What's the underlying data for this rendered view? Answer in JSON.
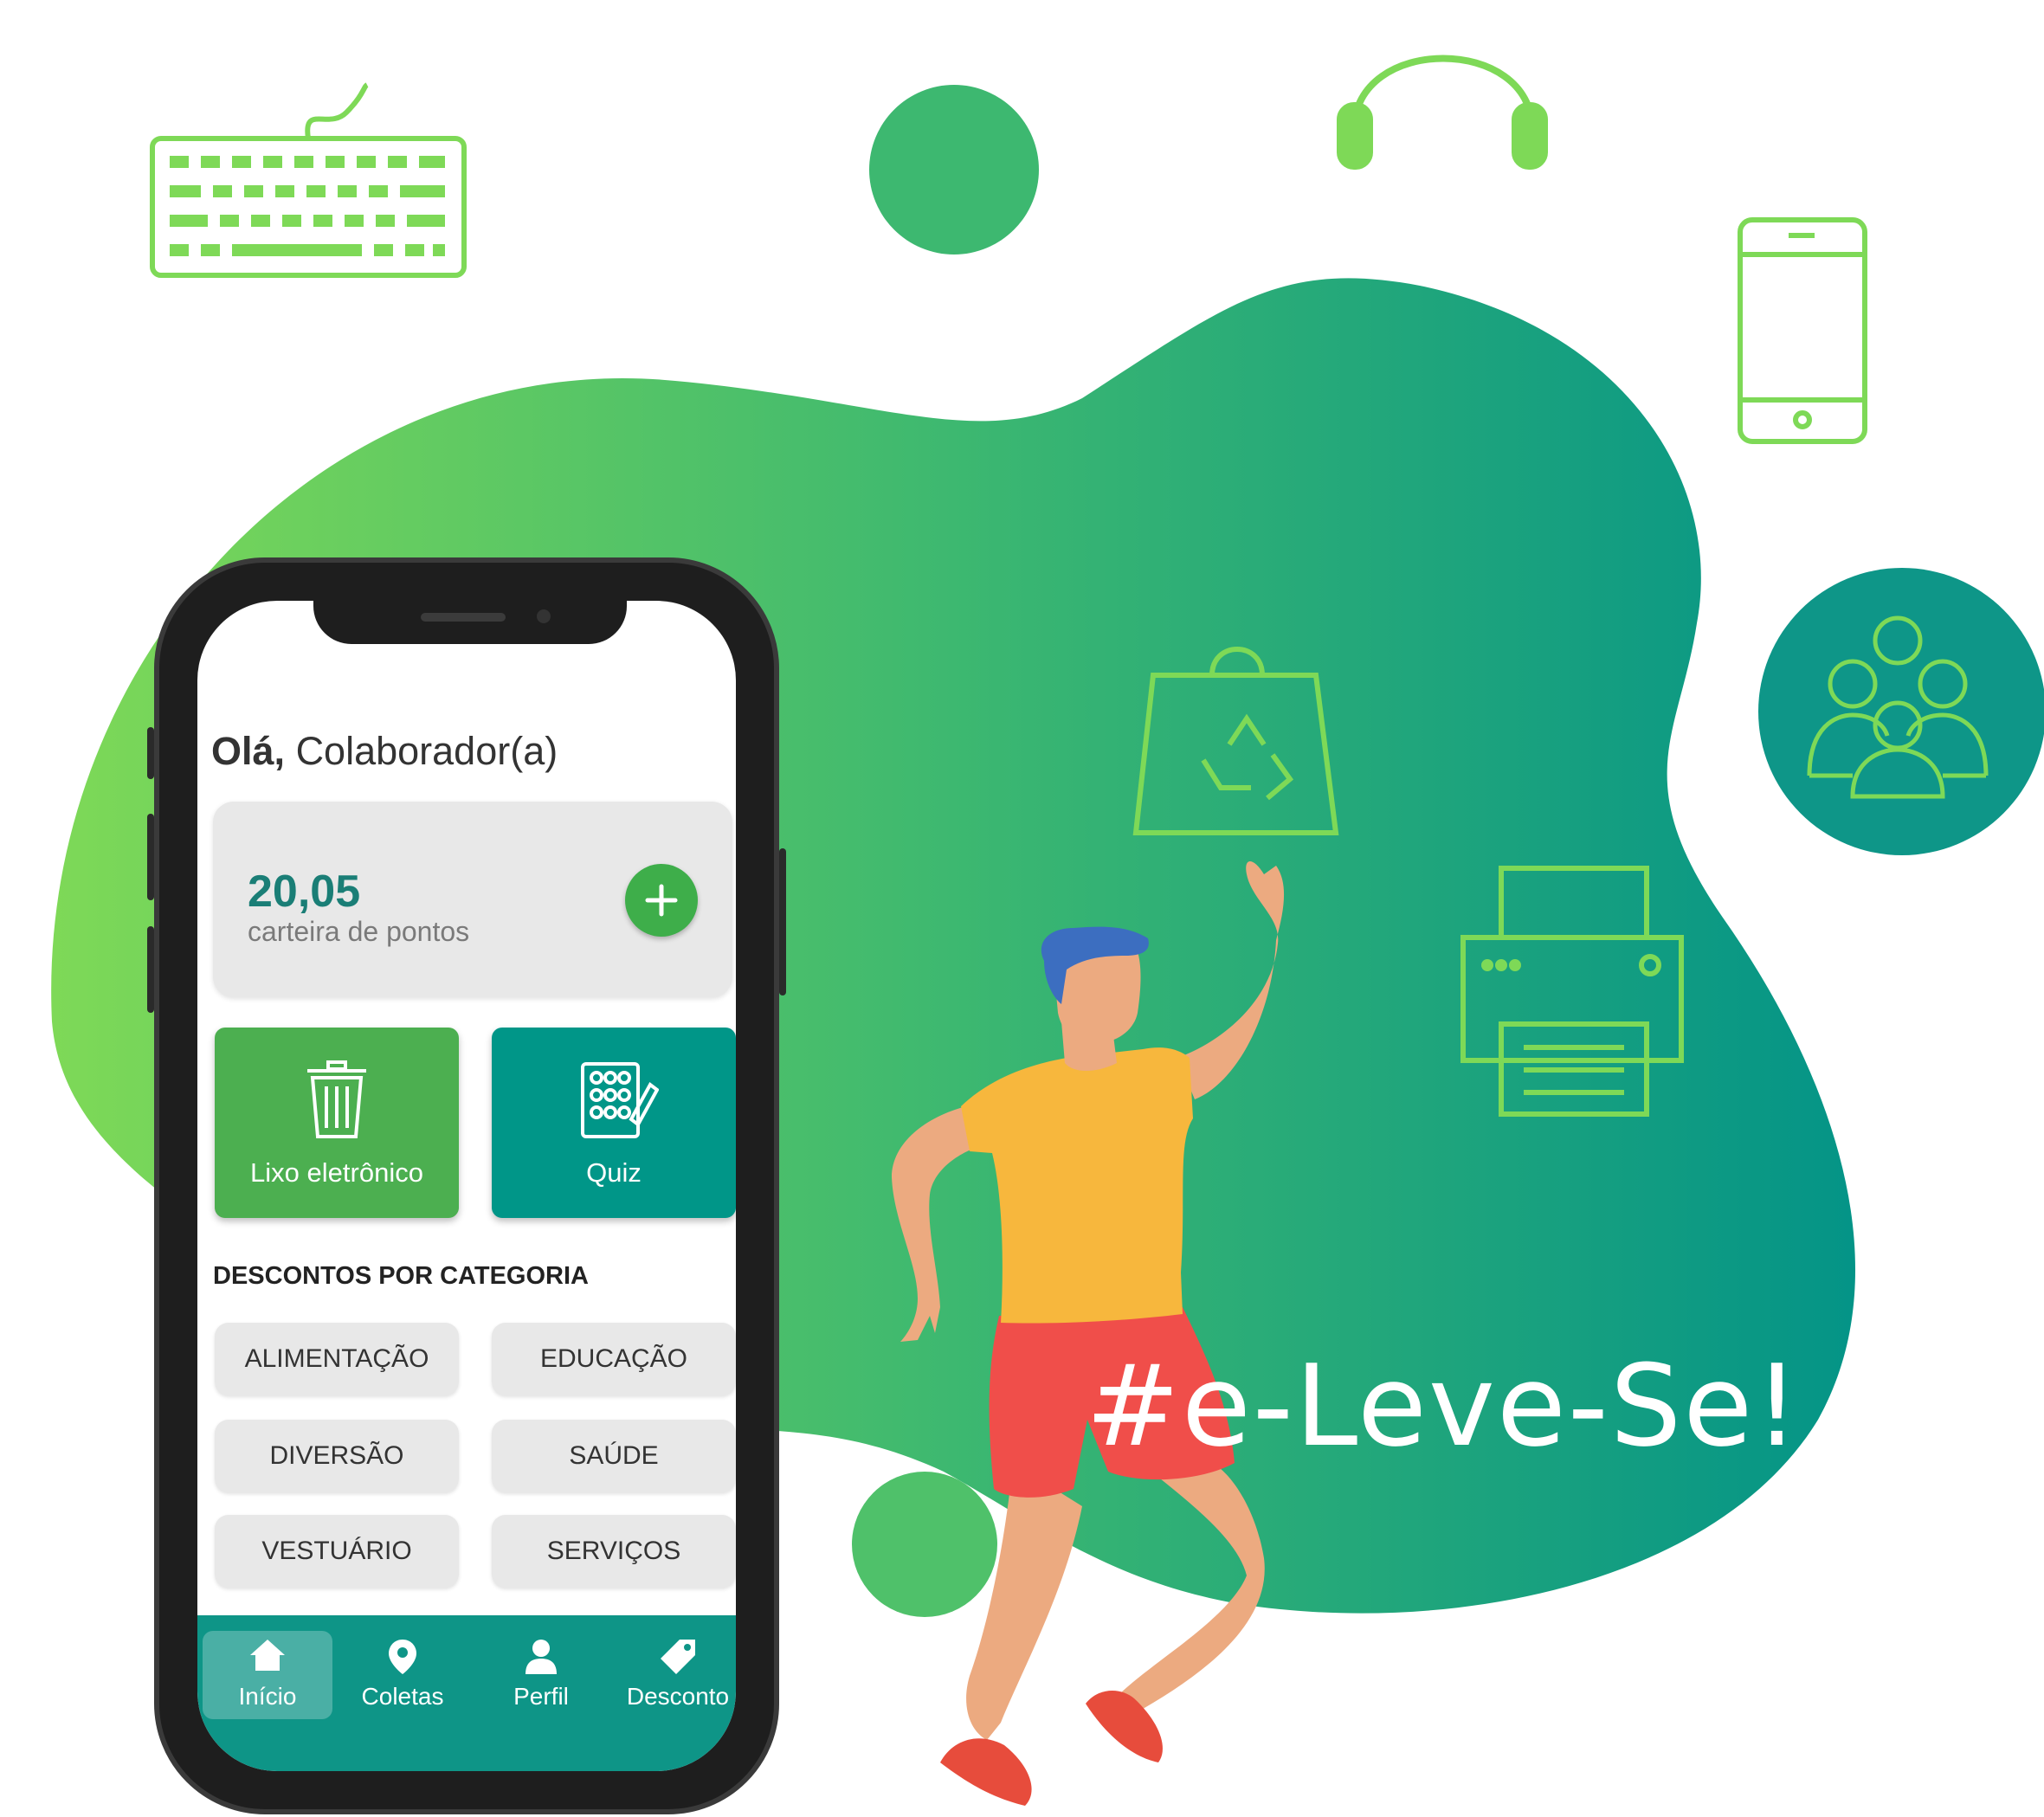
{
  "greeting": {
    "hello": "Olá,",
    "name": "Colaborador(a)"
  },
  "wallet": {
    "points": "20,05",
    "label": "carteira de pontos",
    "add_icon": "plus-icon"
  },
  "tiles": [
    {
      "label": "Lixo eletrônico",
      "icon": "trash-icon",
      "color": "#4caf50"
    },
    {
      "label": "Quiz",
      "icon": "quiz-icon",
      "color": "#009688"
    }
  ],
  "discounts": {
    "title": "DESCONTOS POR CATEGORIA",
    "categories": [
      "ALIMENTAÇÃO",
      "EDUCAÇÃO",
      "DIVERSÃO",
      "SAÚDE",
      "VESTUÁRIO",
      "SERVIÇOS"
    ]
  },
  "nav": [
    {
      "label": "Início",
      "icon": "home-icon",
      "active": true
    },
    {
      "label": "Coletas",
      "icon": "location-pin-icon"
    },
    {
      "label": "Perfil",
      "icon": "user-icon"
    },
    {
      "label": "Desconto",
      "icon": "tag-icon"
    }
  ],
  "hashtag": "#e-Leve-Se!",
  "colors": {
    "accent_green": "#4caf50",
    "accent_teal": "#009688",
    "light_green": "#7fd957",
    "blob_end": "#059487"
  }
}
